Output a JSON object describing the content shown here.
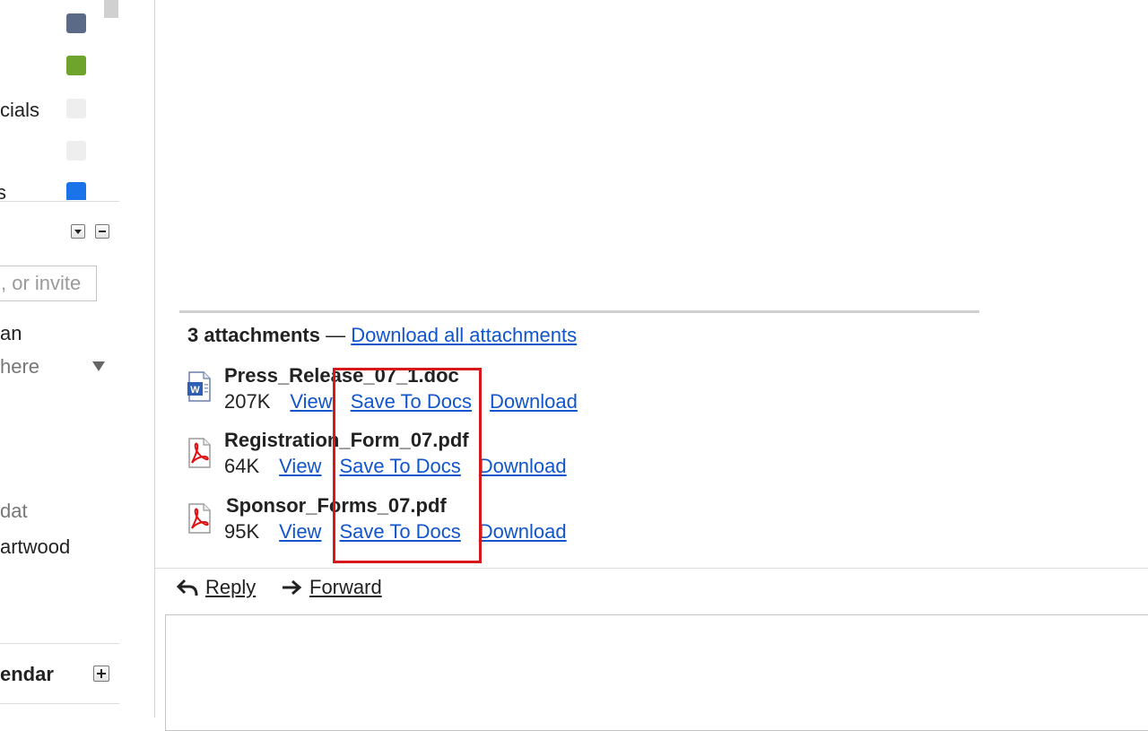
{
  "sidebar": {
    "labels": [
      {
        "text": "cials",
        "color": "#eeeeee"
      },
      {
        "text": "",
        "color": "#eeeeee"
      },
      {
        "text": "s",
        "color": "#1a73e8"
      }
    ],
    "top_swatches": [
      "#5b6a86",
      "#6ea32c"
    ],
    "invite_placeholder": ", or invite",
    "contacts": [
      {
        "text": "an"
      },
      {
        "text": " here"
      },
      {
        "text": "dat"
      },
      {
        "text": "artwood"
      }
    ],
    "calendar_label": "endar"
  },
  "attachments": {
    "count_label": "3 attachments",
    "dash": " — ",
    "download_all": "Download all attachments",
    "items": [
      {
        "name": "Press_Release_07_1.doc",
        "size": "207K",
        "type": "doc",
        "view": "View",
        "save": "Save To Docs",
        "download": "Download"
      },
      {
        "name": "Registration_Form_07.pdf",
        "size": "64K",
        "type": "pdf",
        "view": "View",
        "save": "Save To Docs",
        "download": "Download"
      },
      {
        "name": "Sponsor_Forms_07.pdf",
        "size": "95K",
        "type": "pdf",
        "view": "View",
        "save": "Save To Docs",
        "download": "Download"
      }
    ]
  },
  "actions": {
    "reply": "Reply",
    "forward": "Forward"
  },
  "colors": {
    "link": "#1155cc",
    "highlight": "#d7191c"
  }
}
